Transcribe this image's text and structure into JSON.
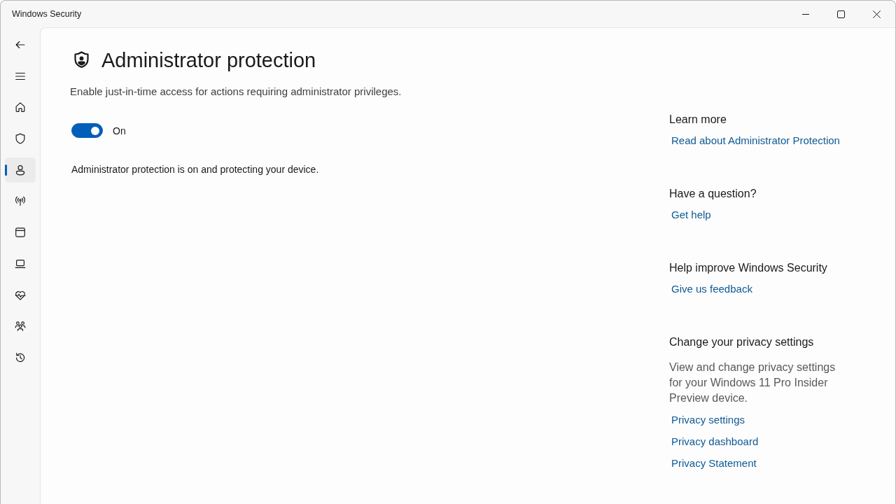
{
  "window": {
    "title": "Windows Security"
  },
  "nav": {
    "items": [
      {
        "selected": false
      },
      {
        "selected": false
      },
      {
        "selected": true
      },
      {
        "selected": false
      },
      {
        "selected": false
      },
      {
        "selected": false
      },
      {
        "selected": false
      },
      {
        "selected": false
      },
      {
        "selected": false
      }
    ]
  },
  "page": {
    "title": "Administrator protection",
    "description": "Enable just-in-time access for actions requiring administrator privileges.",
    "toggle": {
      "on": true,
      "label": "On"
    },
    "status": "Administrator protection is on and protecting your device."
  },
  "side_panel": {
    "sections": [
      {
        "heading": "Learn more",
        "links": [
          "Read about Administrator Protection"
        ]
      },
      {
        "heading": "Have a question?",
        "links": [
          "Get help"
        ]
      },
      {
        "heading": "Help improve Windows Security",
        "links": [
          "Give us feedback"
        ]
      },
      {
        "heading": "Change your privacy settings",
        "text": "View and change privacy settings for your Windows 11 Pro Insider Preview device.",
        "links": [
          "Privacy settings",
          "Privacy dashboard",
          "Privacy Statement"
        ]
      }
    ]
  }
}
